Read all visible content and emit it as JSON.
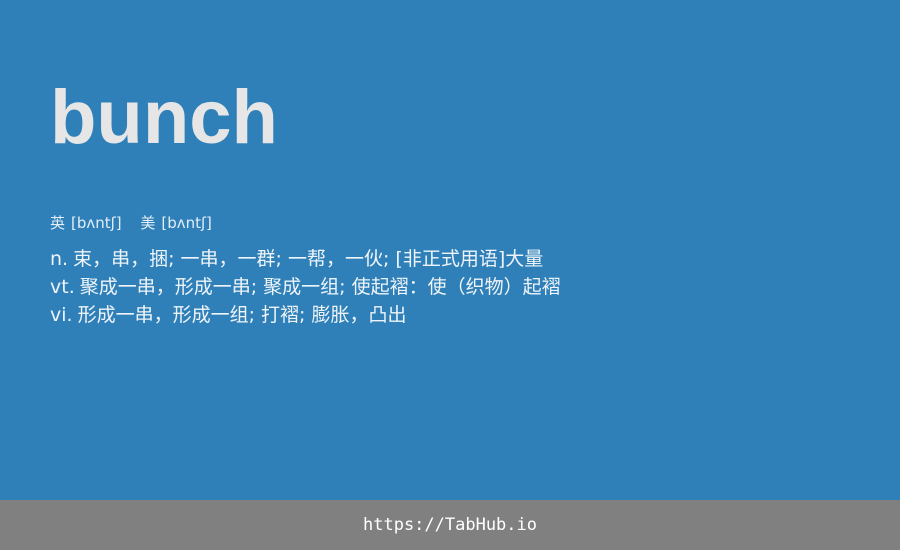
{
  "entry": {
    "word": "bunch",
    "phonetics": [
      {
        "label": "英",
        "ipa": "[bʌntʃ]"
      },
      {
        "label": "美",
        "ipa": "[bʌntʃ]"
      }
    ],
    "definitions": [
      {
        "pos": "n.",
        "text": "束，串，捆; 一串，一群; 一帮，一伙; [非正式用语]大量"
      },
      {
        "pos": "vt.",
        "text": "聚成一串，形成一串; 聚成一组; 使起褶：使（织物）起褶"
      },
      {
        "pos": "vi.",
        "text": "形成一串，形成一组; 打褶; 膨胀，凸出"
      }
    ]
  },
  "footer": {
    "url": "https://TabHub.io"
  },
  "colors": {
    "background": "#2f80b9",
    "footer_background": "#808080",
    "word_text": "#e6e6e6",
    "body_text": "#eef4f9"
  }
}
